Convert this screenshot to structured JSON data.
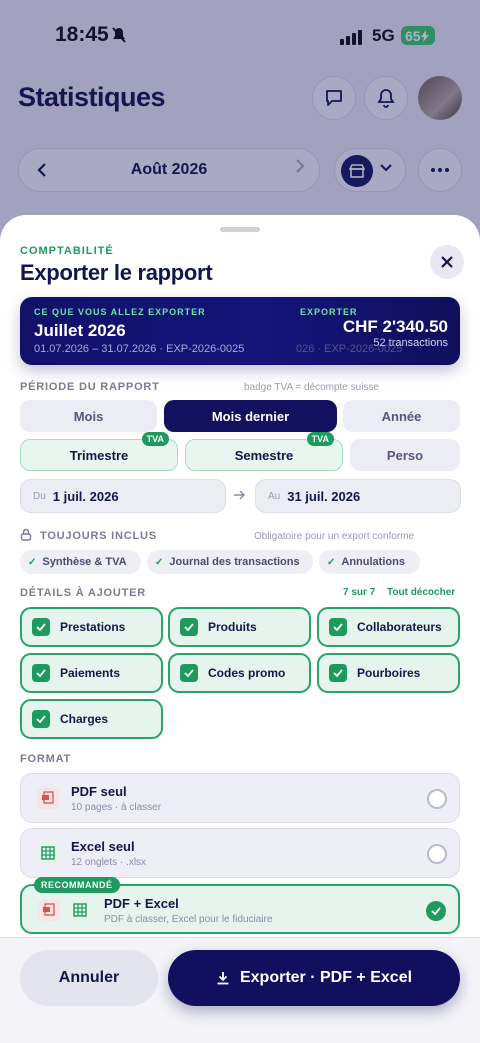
{
  "status_bar": {
    "time": "18:45",
    "network": "5G",
    "battery": "65"
  },
  "background": {
    "title": "Statistiques",
    "month": "Août 2026",
    "icons": [
      "chat-icon",
      "bell-icon",
      "store-icon",
      "more-icon"
    ]
  },
  "sheet": {
    "eyebrow": "COMPTABILITÉ",
    "title": "Exporter le rapport",
    "summary": {
      "tag_left": "CE QUE VOUS ALLEZ EXPORTER",
      "period": "Juillet 2026",
      "meta": "01.07.2026 – 31.07.2026 · EXP-2026-0025",
      "ghost": "026 · EXP-2026-0025",
      "tag_right": "EXPORTER",
      "amount": "CHF 2'340.50",
      "count": "52 transactions"
    },
    "period_section": {
      "label": "PÉRIODE DU RAPPORT",
      "hint": "badge TVA = décompte suisse",
      "options": {
        "mois": "Mois",
        "mois_dernier": "Mois dernier",
        "annee": "Année",
        "trimestre": "Trimestre",
        "semestre": "Semestre",
        "perso": "Perso",
        "tva_badge": "TVA"
      },
      "selected": "Mois dernier",
      "from_prefix": "Du",
      "from_value": "1 juil. 2026",
      "to_prefix": "Au",
      "to_value": "31 juil. 2026"
    },
    "always_section": {
      "label": "TOUJOURS INCLUS",
      "hint": "Obligatoire pour un export conforme",
      "chips": [
        "Synthèse & TVA",
        "Journal des transactions",
        "Annulations"
      ]
    },
    "details_section": {
      "label": "DÉTAILS À AJOUTER",
      "count": "7 sur 7",
      "toggle_all": "Tout décocher",
      "items": [
        "Prestations",
        "Produits",
        "Collaborateurs",
        "Paiements",
        "Codes promo",
        "Pourboires",
        "Charges"
      ]
    },
    "format_section": {
      "label": "FORMAT",
      "options": [
        {
          "name": "PDF seul",
          "sub": "10 pages · à classer"
        },
        {
          "name": "Excel seul",
          "sub": "12 onglets · .xlsx"
        },
        {
          "name": "PDF + Excel",
          "sub": "PDF à classer, Excel pour le fiduciaire",
          "badge": "RECOMMANDÉ"
        }
      ],
      "selected": "PDF + Excel"
    },
    "footer": {
      "cancel": "Annuler",
      "export": "Exporter · PDF + Excel"
    }
  },
  "colors": {
    "accent_navy": "#10105e",
    "accent_green": "#1e9a5e"
  }
}
